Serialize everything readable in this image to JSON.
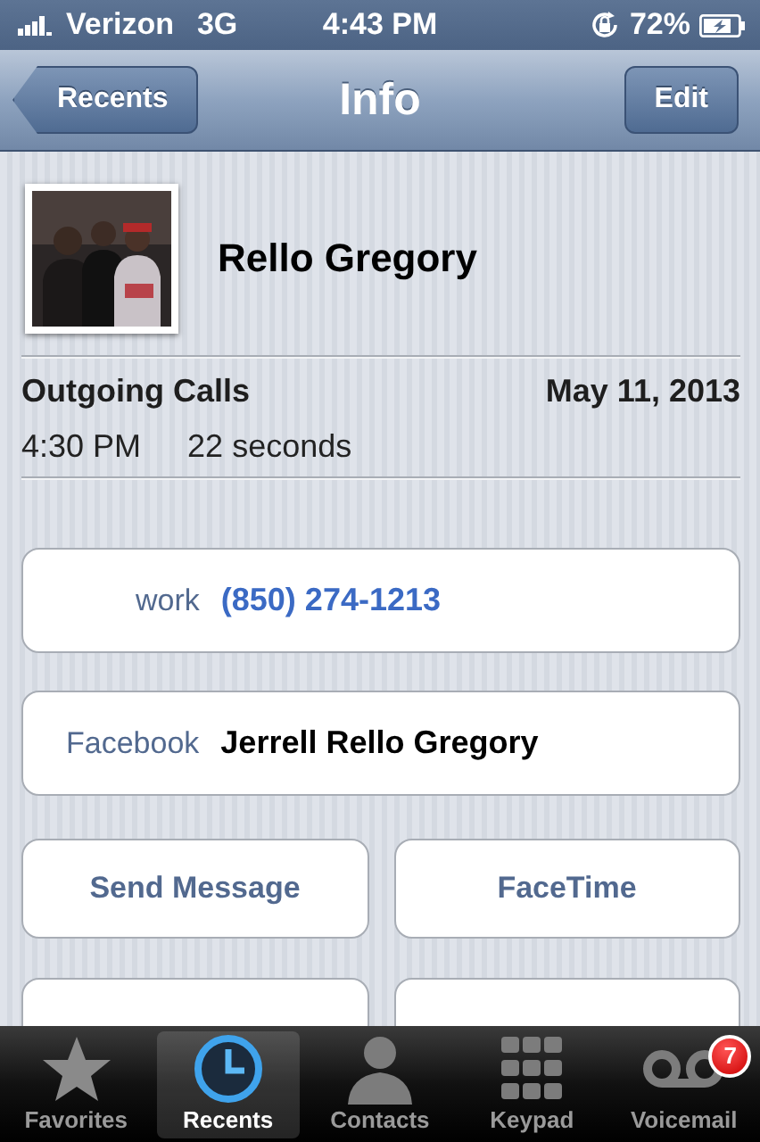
{
  "status_bar": {
    "carrier": "Verizon",
    "network": "3G",
    "time": "4:43 PM",
    "battery": "72%"
  },
  "nav_bar": {
    "back": "Recents",
    "title": "Info",
    "action": "Edit"
  },
  "contact": {
    "name": "Rello Gregory"
  },
  "call": {
    "type": "Outgoing Calls",
    "date": "May 11, 2013",
    "time": "4:30 PM",
    "duration": "22 seconds"
  },
  "fields": [
    {
      "kind": "phone",
      "label": "work",
      "value": "(850) 274-1213"
    },
    {
      "kind": "social",
      "label": "Facebook",
      "value": "Jerrell Rello Gregory"
    }
  ],
  "actions": [
    {
      "label": "Send Message"
    },
    {
      "label": "FaceTime"
    }
  ],
  "tabs": [
    {
      "label": "Favorites",
      "kind": "favorites",
      "selected": false
    },
    {
      "label": "Recents",
      "kind": "recents",
      "selected": true
    },
    {
      "label": "Contacts",
      "kind": "contacts",
      "selected": false
    },
    {
      "label": "Keypad",
      "kind": "keypad",
      "selected": false
    },
    {
      "label": "Voicemail",
      "kind": "voicemail",
      "selected": false,
      "badge": "7"
    }
  ]
}
